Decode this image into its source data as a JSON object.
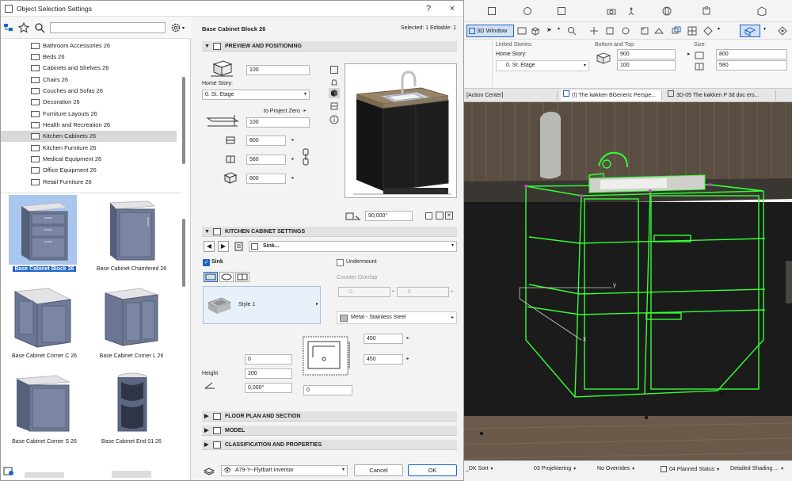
{
  "dialog": {
    "title": "Object Selection Settings",
    "help": "?",
    "close": "×",
    "object_name": "Base Cabinet Block 26",
    "selection_status": "Selected: 1 Editable: 1",
    "search_placeholder": ""
  },
  "tree": [
    {
      "label": "Bathroom Accessories 26"
    },
    {
      "label": "Beds 26"
    },
    {
      "label": "Cabinets and Shelves 26"
    },
    {
      "label": "Chairs 26"
    },
    {
      "label": "Couches and Sofas 26"
    },
    {
      "label": "Decoration 26"
    },
    {
      "label": "Furniture Layouts 26"
    },
    {
      "label": "Health and Recreation 26"
    },
    {
      "label": "Kitchen Cabinets 26",
      "selected": true
    },
    {
      "label": "Kitchen Furniture 26"
    },
    {
      "label": "Medical Equipment 26"
    },
    {
      "label": "Office Equipment 26"
    },
    {
      "label": "Retail Furniture 26"
    }
  ],
  "gallery": [
    {
      "label": "Base Cabinet Block 26",
      "selected": true
    },
    {
      "label": "Base Cabinet Chamfered 26"
    },
    {
      "label": "Base Cabinet Corner C 26"
    },
    {
      "label": "Base Cabinet Corner L 26"
    },
    {
      "label": "Base Cabinet Corner S 26"
    },
    {
      "label": "Base Cabinet End 01 26"
    }
  ],
  "preview_section": {
    "header": "PREVIEW AND POSITIONING",
    "elevation": "100",
    "home_story_label": "Home Story:",
    "home_story_value": "0. St. Etage",
    "project_zero_label": "to Project Zero",
    "project_zero_value": "100",
    "width": "800",
    "depth": "580",
    "height": "800",
    "rotation": "90,000°"
  },
  "kitchen_section": {
    "header": "KITCHEN CABINET SETTINGS",
    "page_dropdown": "Sink...",
    "sink_label": "Sink",
    "sink_checked": true,
    "undermount_label": "Undermount",
    "counter_overlap_label": "Counter Overlap",
    "overlap_left": "0",
    "overlap_right": "0",
    "style_label": "Style 1",
    "material_label": "Metal - Stainless Steel",
    "sink_width": "450",
    "sink_depth": "450",
    "offset": "0",
    "height_label": "Height",
    "height_value": "200",
    "angle_value": "0,000°",
    "bottom_offset": "0"
  },
  "collapsed_sections": [
    {
      "label": "FLOOR PLAN AND SECTION"
    },
    {
      "label": "MODEL"
    },
    {
      "label": "CLASSIFICATION AND PROPERTIES"
    }
  ],
  "footer": {
    "layer": "A79-Y--Flytbart inventar",
    "cancel": "Cancel",
    "ok": "OK"
  },
  "app": {
    "window_button": "3D Window",
    "linked_stories_label": "Linked Stories:",
    "home_story_label": "Home Story:",
    "home_story_value": "0. St. Etage",
    "bottom_top_label": "Bottom and Top:",
    "bottom_value": "900",
    "top_value": "100",
    "size_label": "Size:",
    "size_width": "800",
    "size_depth": "580",
    "tabs": [
      {
        "label": "[Action Center]"
      },
      {
        "label": "(!) The køkken BGeneric Perspe..."
      },
      {
        "label": "3D-05 The køkken P 3d doc ers..."
      }
    ],
    "axis_y": "y",
    "axis_x": "x",
    "status": [
      {
        "label": "_DK Sort"
      },
      {
        "label": "03 Projektering"
      },
      {
        "label": "No Overrides"
      },
      {
        "label": "04 Planned Status"
      },
      {
        "label": "Detailed Shading ..."
      }
    ]
  },
  "colors": {
    "accent": "#1f63c6",
    "selection_green": "#33ff33",
    "cabinet_blue": "#6f7b96"
  }
}
